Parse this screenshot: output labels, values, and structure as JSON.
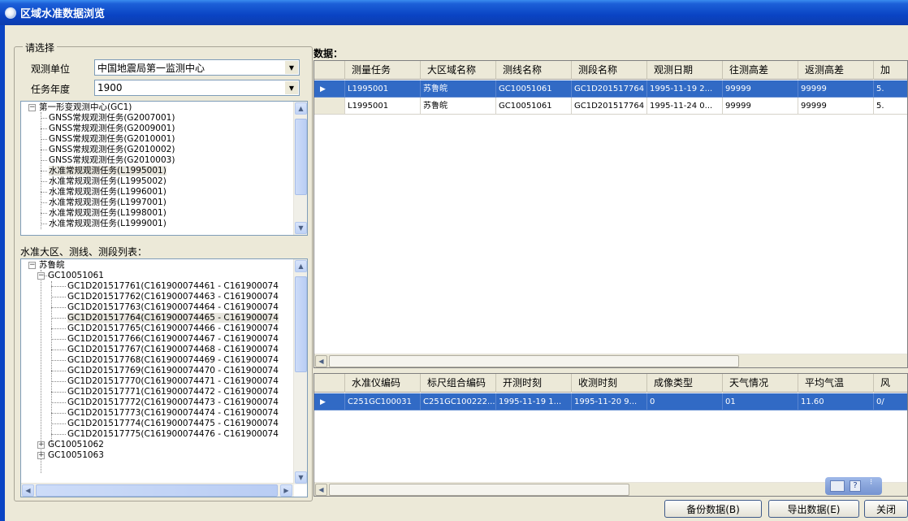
{
  "window": {
    "title": "区域水准数据浏览"
  },
  "filter": {
    "group_title": "请选择",
    "unit_label": "观测单位",
    "unit_value": "中国地震局第一监测中心",
    "year_label": "任务年度",
    "year_value": "1900"
  },
  "task_tree": {
    "root": "第一形变观测中心(GC1)",
    "items": [
      "GNSS常规观测任务(G2007001)",
      "GNSS常规观测任务(G2009001)",
      "GNSS常规观测任务(G2010001)",
      "GNSS常规观测任务(G2010002)",
      "GNSS常规观测任务(G2010003)",
      "水准常规观测任务(L1995001)",
      "水准常规观测任务(L1995002)",
      "水准常规观测任务(L1996001)",
      "水准常规观测任务(L1997001)",
      "水准常规观测任务(L1998001)",
      "水准常规观测任务(L1999001)"
    ]
  },
  "segment_tree": {
    "label": "水准大区、测线、测段列表：",
    "region": "苏鲁皖",
    "line": "GC10051061",
    "segments": [
      "GC1D201517761(C161900074461 - C16190007­4",
      "GC1D201517762(C161900074463 - C16190007­4",
      "GC1D201517763(C161900074464 - C16190007­4",
      "GC1D201517764(C161900074465 - C16190007­4",
      "GC1D201517765(C161900074466 - C16190007­4",
      "GC1D201517766(C161900074467 - C16190007­4",
      "GC1D201517767(C161900074468 - C16190007­4",
      "GC1D201517768(C161900074469 - C16190007­4",
      "GC1D201517769(C161900074470 - C16190007­4",
      "GC1D201517770(C161900074471 - C16190007­4",
      "GC1D201517771(C161900074472 - C16190007­4",
      "GC1D201517772(C161900074473 - C16190007­4",
      "GC1D201517773(C161900074474 - C16190007­4",
      "GC1D201517774(C161900074475 - C16190007­4",
      "GC1D201517775(C161900074476 - C16190007­4"
    ],
    "other_lines": [
      "GC10051062",
      "GC10051063"
    ]
  },
  "data_label": "数据：",
  "main_grid": {
    "headers": [
      "测量任务",
      "大区域名称",
      "测线名称",
      "测段名称",
      "观测日期",
      "往测高差",
      "返测高差",
      "加"
    ],
    "rows": [
      [
        "L1995001",
        "苏鲁皖",
        "GC10051061",
        "GC1D201517764",
        "1995-11-19 2...",
        "99999",
        "99999",
        "5."
      ],
      [
        "L1995001",
        "苏鲁皖",
        "GC10051061",
        "GC1D201517764",
        "1995-11-24 0...",
        "99999",
        "99999",
        "5."
      ]
    ]
  },
  "detail_grid": {
    "headers": [
      "水准仪编码",
      "标尺组合编码",
      "开测时刻",
      "收测时刻",
      "成像类型",
      "天气情况",
      "平均气温",
      "风"
    ],
    "rows": [
      [
        "C251GC100031",
        "C251GC100222...",
        "1995-11-19 1...",
        "1995-11-20 9...",
        "0",
        "01",
        "11.60",
        "0/"
      ]
    ]
  },
  "buttons": {
    "backup": "备份数据(B)",
    "export": "导出数据(E)",
    "close": "关闭"
  }
}
